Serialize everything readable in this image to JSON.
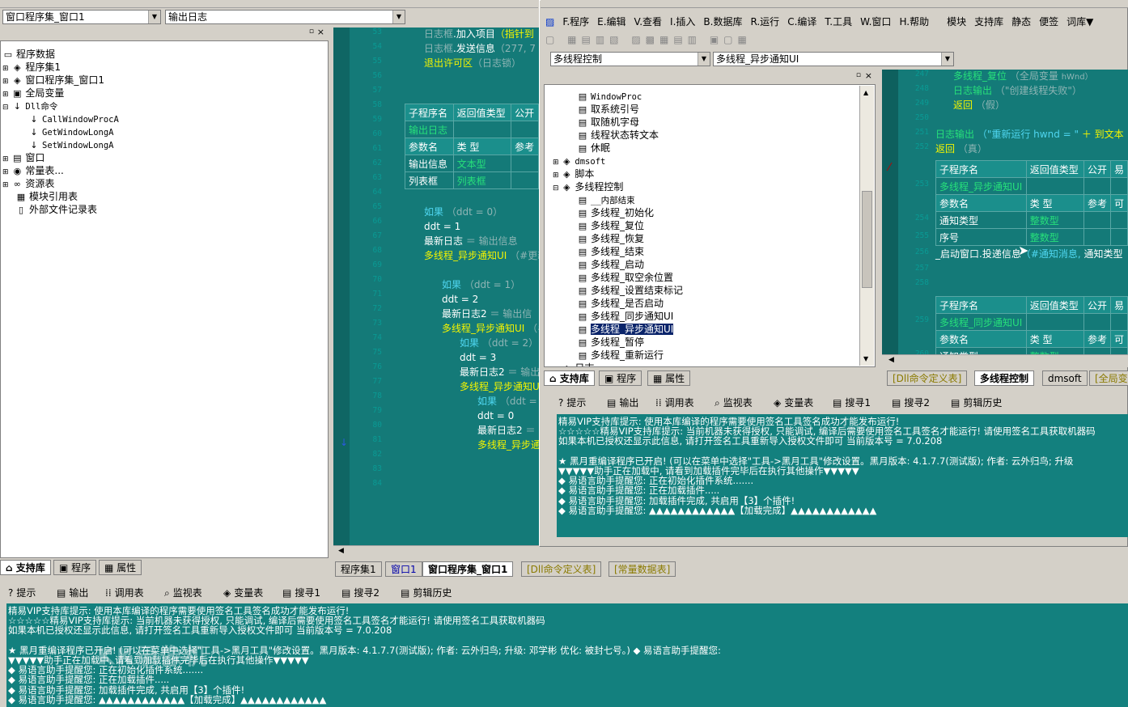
{
  "left": {
    "combo_window": "窗口程序集_窗口1",
    "combo_event": "输出日志",
    "tree": [
      {
        "label": "程序数据",
        "icon": "doc-icon"
      },
      {
        "label": "程序集1",
        "icon": "module-icon"
      },
      {
        "label": "窗口程序集_窗口1",
        "icon": "module-icon"
      },
      {
        "label": "全局变量",
        "icon": "var-icon"
      },
      {
        "label": "Dll命令",
        "icon": "dll-icon"
      },
      {
        "label": "CallWindowProcA",
        "icon": "dll-icon"
      },
      {
        "label": "GetWindowLongA",
        "icon": "dll-icon"
      },
      {
        "label": "SetWindowLongA",
        "icon": "dll-icon"
      },
      {
        "label": "窗口",
        "icon": "window-icon"
      },
      {
        "label": "常量表...",
        "icon": "const-icon"
      },
      {
        "label": "资源表",
        "icon": "res-icon"
      },
      {
        "label": "模块引用表",
        "icon": "mod-icon"
      },
      {
        "label": "外部文件记录表",
        "icon": "file-icon"
      }
    ],
    "bottom_tabs": [
      "支持库",
      "程序",
      "属性"
    ]
  },
  "code1": {
    "lines": [
      "53",
      "54",
      "55",
      "56",
      "57",
      "58",
      "59",
      "60",
      "61",
      "62",
      "63",
      "64",
      "65",
      "66",
      "67",
      "68",
      "69",
      "70",
      "71",
      "72",
      "73",
      "74",
      "75",
      "76",
      "77",
      "78",
      "79",
      "80",
      "81",
      "82",
      "83",
      "84"
    ],
    "top": [
      {
        "a": "日志框",
        "b": ".加入项目",
        "c": "（指针到"
      },
      {
        "a": "日志框",
        "b": ".发送信息",
        "c": "（277, 7"
      },
      {
        "a": "退出许可区",
        "b": "",
        "c": "（日志锁）"
      }
    ],
    "table": {
      "h1": [
        "子程序名",
        "返回值类型",
        "公开"
      ],
      "name": "输出日志",
      "h2": [
        "参数名",
        "类 型",
        "参考"
      ],
      "r1": [
        "输出信息",
        "文本型"
      ],
      "r2": [
        "列表框",
        "列表框"
      ]
    },
    "body": [
      [
        "如果",
        "（ddt = 0）"
      ],
      [
        "ddt = 1",
        ""
      ],
      [
        "最新日志",
        "＝ 输出信息"
      ],
      [
        "多线程_异步通知UI",
        "（#更新"
      ],
      [
        "如果",
        "（ddt = 1）"
      ],
      [
        "ddt = 2",
        ""
      ],
      [
        "最新日志2",
        "＝ 输出信"
      ],
      [
        "多线程_异步通知UI",
        "（#"
      ],
      [
        "如果",
        "（ddt = 2）"
      ],
      [
        "ddt = 3",
        ""
      ],
      [
        "最新日志2",
        "＝ 输出"
      ],
      [
        "多线程_异步通知U",
        "("
      ],
      [
        "如果",
        "（ddt ="
      ],
      [
        "ddt = 0",
        ""
      ],
      [
        "最新日志2",
        "＝"
      ],
      [
        "多线程_异步通",
        ""
      ]
    ],
    "bottom_tabs": [
      "程序集1",
      "窗口1",
      "窗口程序集_窗口1",
      "[Dll命令定义表]",
      "[常量数据表]"
    ]
  },
  "right": {
    "menu": [
      "F.程序",
      "E.编辑",
      "V.查看",
      "I.插入",
      "B.数据库",
      "R.运行",
      "C.编译",
      "T.工具",
      "W.窗口",
      "H.帮助",
      "模块",
      "支持库",
      "静态",
      "便签",
      "词库▼"
    ],
    "combo_a": "多线程控制",
    "combo_b": "多线程_异步通知UI",
    "tree": [
      "WindowProc",
      "取系统引号",
      "取随机字母",
      "线程状态转文本",
      "休眠",
      "dmsoft",
      "脚本",
      "多线程控制",
      "__内部结束",
      "多线程_初始化",
      "多线程_复位",
      "多线程_恢复",
      "多线程_结束",
      "多线程_启动",
      "多线程_取空余位置",
      "多线程_设置结束标记",
      "多线程_是否启动",
      "多线程_同步通知UI",
      "多线程_异步通知UI",
      "多线程_暂停",
      "多线程_重新运行",
      "日志"
    ],
    "tree_tabs": [
      "支持库",
      "程序",
      "属性"
    ],
    "code_lines": [
      "247",
      "248",
      "249",
      "250",
      "251",
      "252",
      "253",
      "254",
      "255",
      "256",
      "257",
      "258",
      "259",
      "260"
    ],
    "code_top": [
      {
        "a": "多线程_复位",
        "b": "（全局变量",
        "c": "hWnd）"
      },
      {
        "a": "日志输出",
        "b": "（\"创建线程失败\"）",
        "c": ""
      },
      {
        "a": "返回",
        "b": "（假）",
        "c": ""
      },
      {
        "a": "日志输出",
        "b": "（\"重新运行 hwnd = \"",
        "c": "＋ 到文本"
      },
      {
        "a": "返回",
        "b": "（真）",
        "c": ""
      }
    ],
    "table1": {
      "h1": [
        "子程序名",
        "返回值类型",
        "公开",
        "易"
      ],
      "name": "多线程_异步通知UI",
      "h2": [
        "参数名",
        "类 型",
        "参考",
        "可"
      ],
      "r1": [
        "通知类型",
        "整数型"
      ],
      "r2": [
        "序号",
        "整数型"
      ]
    },
    "call_line": [
      "_启动窗口.投递信息",
      "（#通知消息,",
      "通知类型"
    ],
    "table2": {
      "h1": [
        "子程序名",
        "返回值类型",
        "公开",
        "易"
      ],
      "name": "多线程_同步通知UI",
      "h2": [
        "参数名",
        "类 型",
        "参考",
        "可"
      ],
      "r1": [
        "通知类型",
        "整数型"
      ]
    },
    "code_tabs": [
      "[Dll命令定义表]",
      "多线程控制",
      "dmsoft",
      "[全局变"
    ],
    "out_tabs": [
      "提示",
      "输出",
      "调用表",
      "监视表",
      "变量表",
      "搜寻1",
      "搜寻2",
      "剪辑历史"
    ],
    "output": [
      "精易VIP支持库提示: 使用本库编译的程序需要使用签名工具签名成功才能发布运行!",
      "☆☆☆☆☆精易VIP支持库提示: 当前机器未获得授权, 只能调试, 编译后需要使用签名工具签名才能运行!  请使用签名工具获取机器码",
      "如果本机已授权还显示此信息, 请打开签名工具重新导入授权文件即可     当前版本号 = 7.0.208",
      "",
      "★ 黑月重编译程序已开启!  (可以在菜单中选择\"工具->黑月工具\"修改设置。黑月版本: 4.1.7.7(测试版); 作者: 云外归鸟; 升级",
      "▼▼▼▼▼助手正在加载中, 请看到加载插件完毕后在执行其他操作▼▼▼▼▼",
      "◆ 易语言助手提醒您: 正在初始化插件系统.......",
      "◆ 易语言助手提醒您: 正在加载插件.....",
      "◆ 易语言助手提醒您: 加载插件完成, 共启用【3】个插件!",
      "◆ 易语言助手提醒您: ▲▲▲▲▲▲▲▲▲▲▲▲【加载完成】▲▲▲▲▲▲▲▲▲▲▲▲"
    ]
  },
  "bottom": {
    "tabs": [
      "提示",
      "输出",
      "调用表",
      "监视表",
      "变量表",
      "搜寻1",
      "搜寻2",
      "剪辑历史"
    ],
    "output": [
      "精易VIP支持库提示: 使用本库编译的程序需要使用签名工具签名成功才能发布运行!",
      "☆☆☆☆☆精易VIP支持库提示: 当前机器未获得授权, 只能调试, 编译后需要使用签名工具签名才能运行!  请使用签名工具获取机器码",
      "如果本机已授权还显示此信息, 请打开签名工具重新导入授权文件即可     当前版本号 = 7.0.208",
      "",
      "★ 黑月重编译程序已开启!  (可以在菜单中选择\"工具->黑月工具\"修改设置。黑月版本: 4.1.7.7(测试版); 作者: 云外归鸟; 升级: 邓学彬 优化: 被封七号。) ◆ 易语言助手提醒您:",
      "▼▼▼▼▼助手正在加载中, 请看到加载插件完毕后在执行其他操作▼▼▼▼▼",
      "◆ 易语言助手提醒您: 正在初始化插件系统.......",
      "◆ 易语言助手提醒您: 正在加载插件.....",
      "◆ 易语言助手提醒您: 加载插件完成, 共启用【3】个插件!",
      "◆ 易语言助手提醒您: ▲▲▲▲▲▲▲▲▲▲▲▲【加载完成】▲▲▲▲▲▲▲▲▲▲▲▲"
    ],
    "watermark": "KK录像机"
  }
}
